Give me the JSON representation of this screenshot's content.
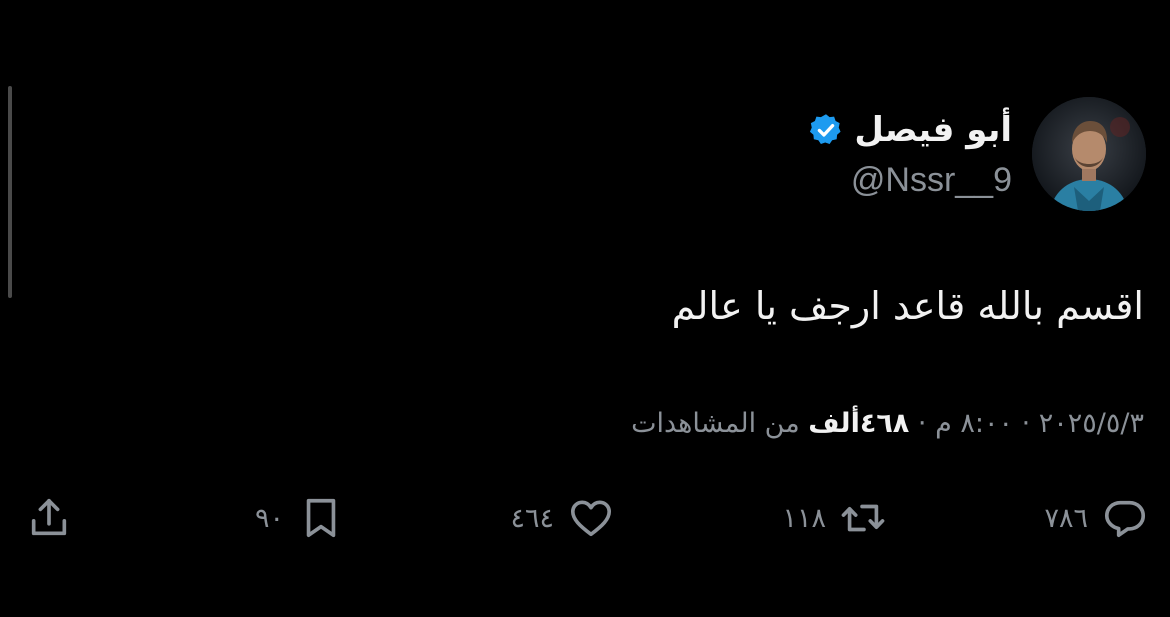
{
  "tweet": {
    "author": {
      "display_name": "أبو فيصل",
      "handle": "@Nssr__9",
      "verified": true
    },
    "text": "اقسم بالله قاعد ارجف يا عالم",
    "meta": {
      "date": "٢٠٢٥/٥/٣",
      "time": "٨:٠٠ م",
      "separator": "·",
      "views_count": "٤٦٨ألف",
      "views_label": "من المشاهدات"
    },
    "actions": {
      "replies": "٧٨٦",
      "reposts": "١١٨",
      "likes": "٤٦٤",
      "bookmarks": "٩٠"
    }
  },
  "colors": {
    "background": "#000000",
    "text_primary": "#f2f2f2",
    "text_secondary": "#8b9198",
    "verified_badge": "#1d9bf0"
  },
  "icons": [
    "verified-badge-icon",
    "reply-icon",
    "repost-icon",
    "like-icon",
    "bookmark-icon",
    "share-icon"
  ]
}
